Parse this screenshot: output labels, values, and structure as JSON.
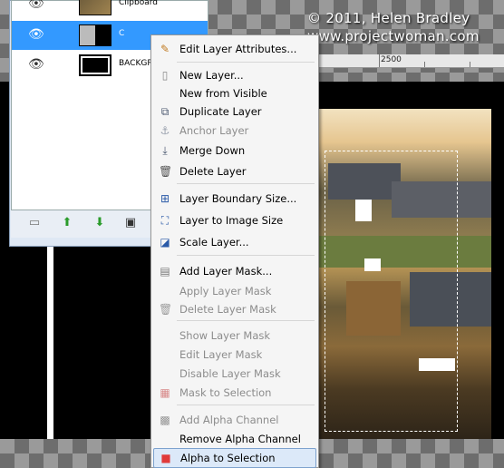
{
  "watermark": {
    "line1": "© 2011, Helen Bradley",
    "line2": "www.projectwoman.com"
  },
  "ruler": {
    "label": "2500"
  },
  "layers_panel": {
    "layers": [
      {
        "name": "Clipboard",
        "visible": true,
        "selected": false
      },
      {
        "name": "C",
        "visible": true,
        "selected": true
      },
      {
        "name": "BACKGR",
        "visible": true,
        "selected": false
      }
    ],
    "buttons": [
      "new-layer-icon",
      "raise-layer-icon",
      "lower-layer-icon",
      "duplicate-layer-icon"
    ]
  },
  "context_menu": {
    "items": [
      {
        "label": "Edit Layer Attributes...",
        "icon": "edit-attributes-icon",
        "enabled": true
      },
      {
        "label": "New Layer...",
        "icon": "new-layer-icon",
        "enabled": true
      },
      {
        "label": "New from Visible",
        "icon": "",
        "enabled": true
      },
      {
        "label": "Duplicate Layer",
        "icon": "duplicate-layer-icon",
        "enabled": true
      },
      {
        "label": "Anchor Layer",
        "icon": "anchor-icon",
        "enabled": false
      },
      {
        "label": "Merge Down",
        "icon": "merge-down-icon",
        "enabled": true
      },
      {
        "label": "Delete Layer",
        "icon": "delete-layer-icon",
        "enabled": true
      },
      {
        "label": "Layer Boundary Size...",
        "icon": "layer-boundary-icon",
        "enabled": true
      },
      {
        "label": "Layer to Image Size",
        "icon": "layer-to-image-icon",
        "enabled": true
      },
      {
        "label": "Scale Layer...",
        "icon": "scale-layer-icon",
        "enabled": true
      },
      {
        "label": "Add Layer Mask...",
        "icon": "add-mask-icon",
        "enabled": true
      },
      {
        "label": "Apply Layer Mask",
        "icon": "",
        "enabled": false
      },
      {
        "label": "Delete Layer Mask",
        "icon": "delete-mask-icon",
        "enabled": false
      },
      {
        "label": "Show Layer Mask",
        "icon": "",
        "enabled": false
      },
      {
        "label": "Edit Layer Mask",
        "icon": "",
        "enabled": false
      },
      {
        "label": "Disable Layer Mask",
        "icon": "",
        "enabled": false
      },
      {
        "label": "Mask to Selection",
        "icon": "mask-to-selection-icon",
        "enabled": false
      },
      {
        "label": "Add Alpha Channel",
        "icon": "add-alpha-icon",
        "enabled": false
      },
      {
        "label": "Remove Alpha Channel",
        "icon": "",
        "enabled": true
      },
      {
        "label": "Alpha to Selection",
        "icon": "alpha-to-selection-icon",
        "enabled": true,
        "highlighted": true
      }
    ]
  }
}
